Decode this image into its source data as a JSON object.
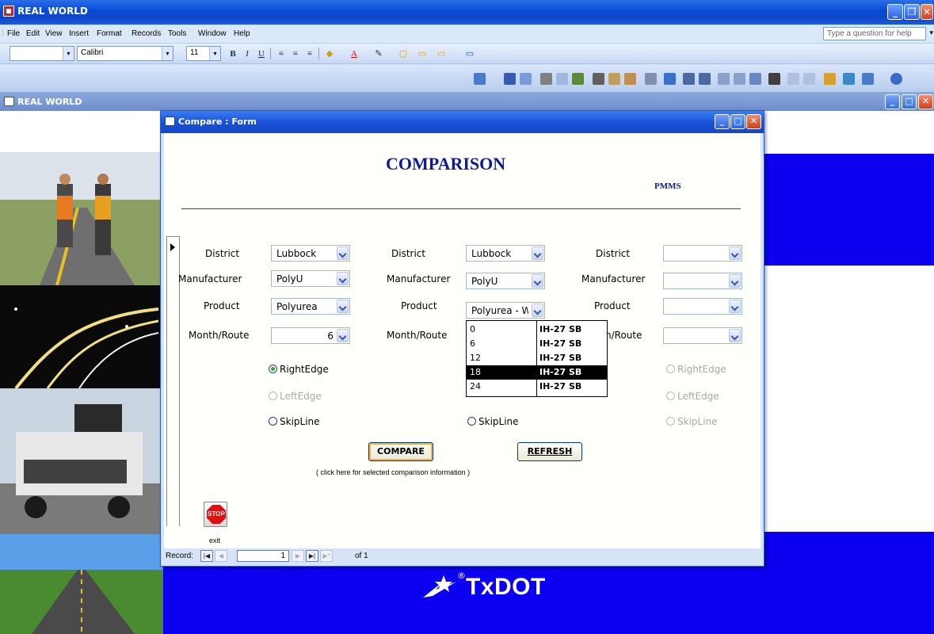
{
  "app": {
    "title": "REAL WORLD",
    "menu": [
      "File",
      "Edit",
      "View",
      "Insert",
      "Format",
      "Records",
      "Tools",
      "Window",
      "Help"
    ],
    "help_placeholder": "Type a question for help"
  },
  "toolbar": {
    "font_name": "Calibri",
    "font_size": "11"
  },
  "mdi": {
    "title": "REAL WORLD"
  },
  "form": {
    "title": "Compare : Form",
    "heading": "COMPARISON",
    "pmms": "PMMS",
    "labels": {
      "district": "District",
      "manufacturer": "Manufacturer",
      "product": "Product",
      "month_route": "Month/Route"
    },
    "col1": {
      "district": "Lubbock",
      "manufacturer": "PolyU",
      "product": "Polyurea",
      "month_route": "6"
    },
    "col2": {
      "district": "Lubbock",
      "manufacturer": "PolyU",
      "product": "Polyurea - Wh",
      "month_route": "18"
    },
    "col3": {
      "district": "",
      "manufacturer": "",
      "product": "",
      "month_route": ""
    },
    "radios": {
      "right": "RightEdge",
      "left": "LeftEdge",
      "skip": "SkipLine",
      "skip_partial": "SkipLine"
    },
    "col1_selected": "RightEdge",
    "compare_label": "COMPARE",
    "refresh_label": "REFRESH",
    "compare_note": "( click here for selected comparison information )",
    "stop_label": "STOP",
    "exit_label": "exit"
  },
  "dropdown": {
    "rows": [
      {
        "month": "0",
        "route": "IH-27 SB"
      },
      {
        "month": "6",
        "route": "IH-27 SB"
      },
      {
        "month": "12",
        "route": "IH-27 SB"
      },
      {
        "month": "18",
        "route": "IH-27 SB"
      },
      {
        "month": "24",
        "route": "IH-27 SB"
      }
    ],
    "selected_index": 3
  },
  "record_nav": {
    "label": "Record:",
    "current": "1",
    "of_text": "of 1"
  },
  "logo": {
    "text": "TxDOT",
    "mark": "®"
  },
  "colors": {
    "background_blue": "#0b00f0",
    "heading_blue": "#0a1a9a",
    "titlebar_blue": "#1a50d8"
  }
}
